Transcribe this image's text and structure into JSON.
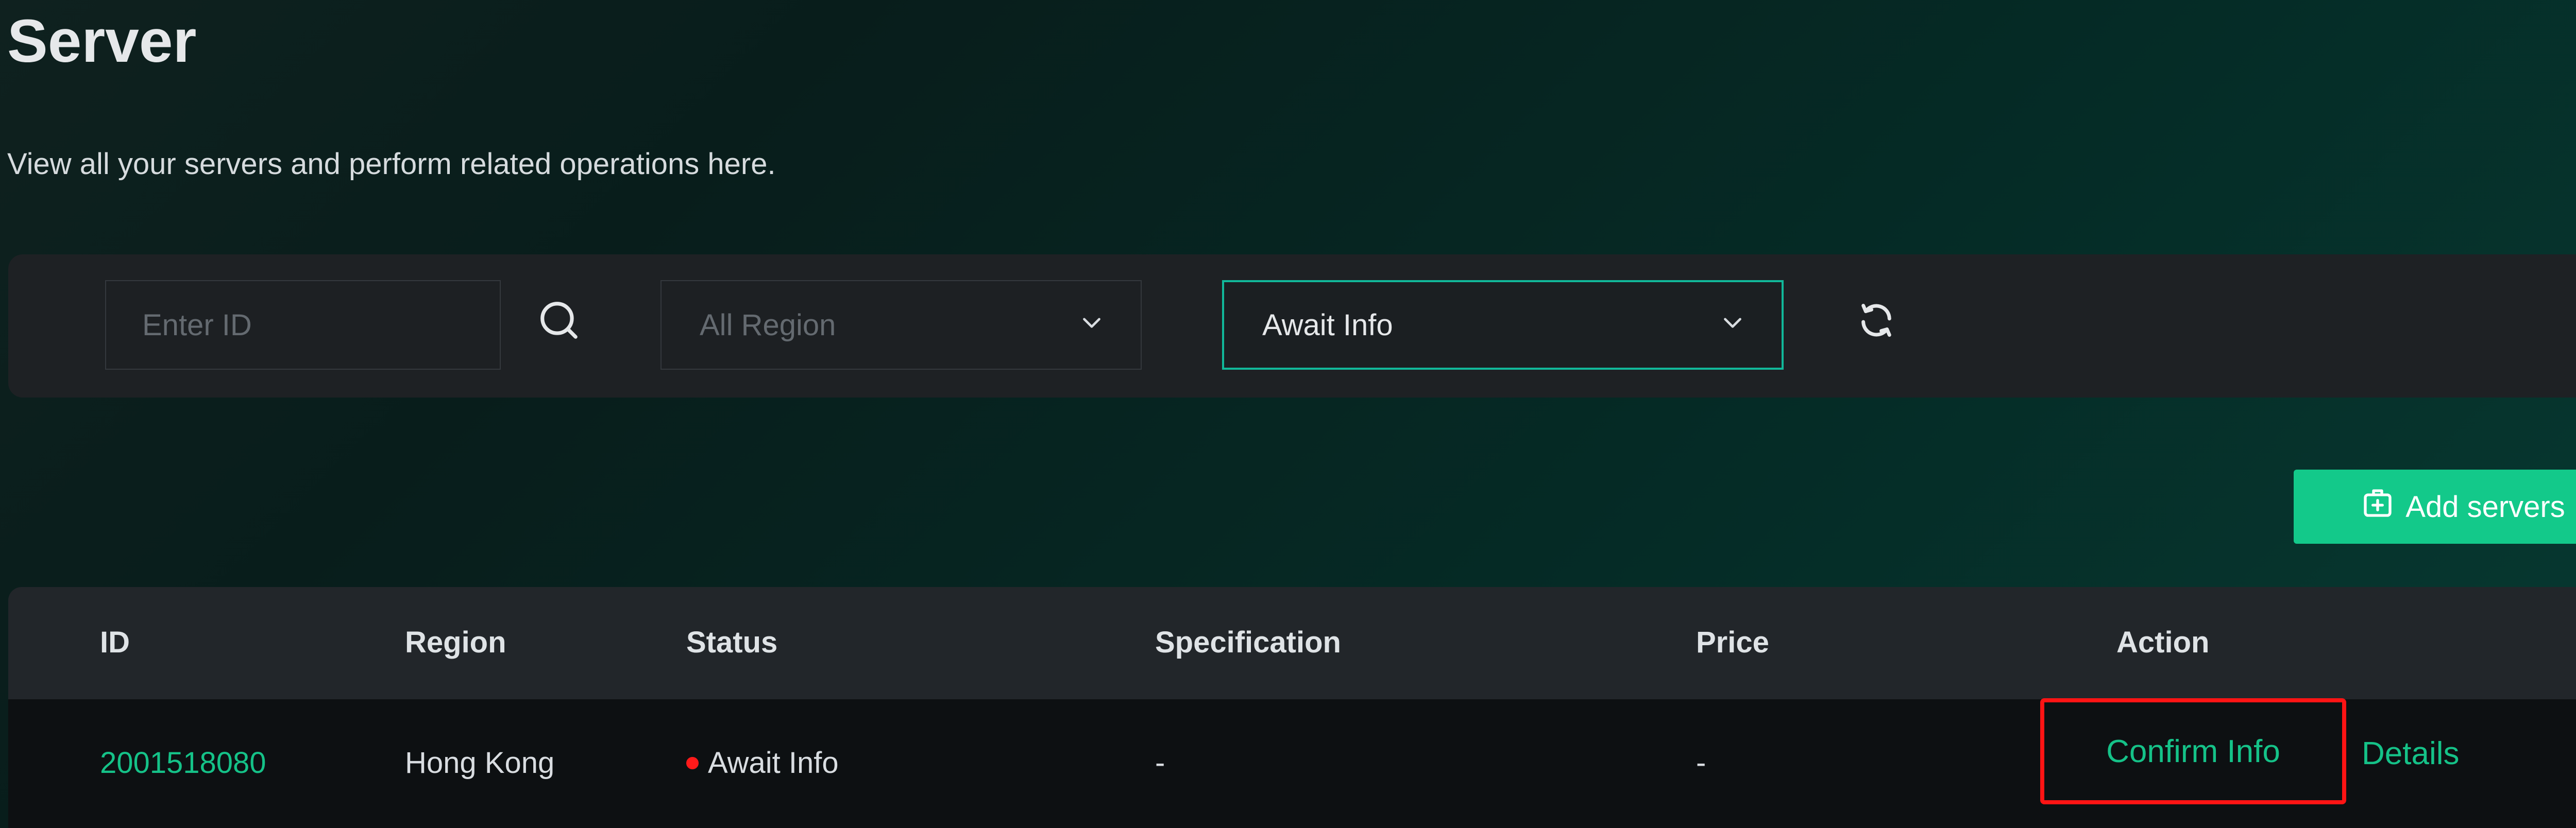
{
  "page": {
    "title": "Server",
    "subtitle": "View all your servers and perform related operations here."
  },
  "filters": {
    "id_placeholder": "Enter ID",
    "region_placeholder": "All Region",
    "status_value": "Await Info",
    "icons": {
      "search": "search-icon",
      "region_dropdown": "chevron-down-icon",
      "status_dropdown": "chevron-down-icon",
      "refresh": "refresh-icon"
    }
  },
  "add_button": {
    "label": "Add servers",
    "icon": "add-box-icon"
  },
  "table": {
    "columns": [
      "ID",
      "Region",
      "Status",
      "Specification",
      "Price",
      "Action"
    ],
    "rows": [
      {
        "id": "2001518080",
        "region": "Hong Kong",
        "status": "Await Info",
        "specification": "-",
        "price": "-",
        "actions": [
          "Confirm Info",
          "Details"
        ]
      }
    ]
  },
  "colors": {
    "accent": "#13c98a",
    "link": "#15c288",
    "status_dot": "#ff1a1a",
    "highlight_border": "#ff1414",
    "select_focus_border": "#11b89a"
  }
}
